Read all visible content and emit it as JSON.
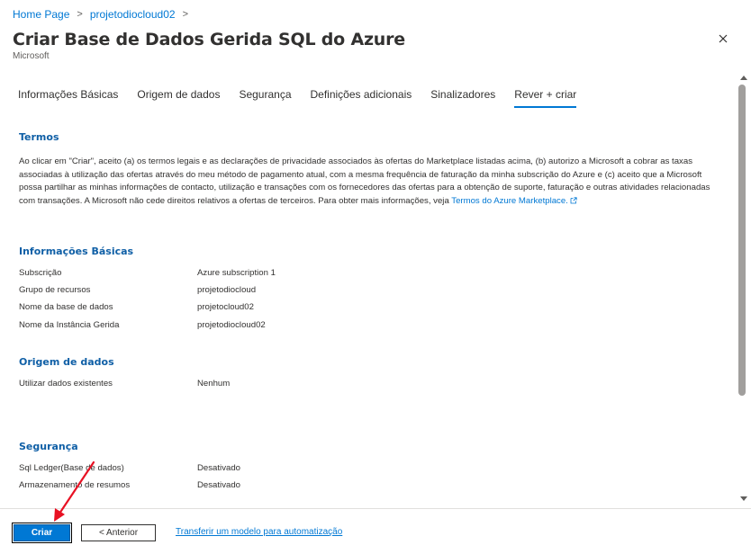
{
  "breadcrumb": {
    "items": [
      "Home Page",
      "projetodiocloud02"
    ],
    "separator": ">"
  },
  "header": {
    "title": "Criar Base de Dados Gerida SQL do Azure",
    "more_label": "···",
    "subtitle": "Microsoft",
    "close_icon": "close-icon"
  },
  "tabs": [
    {
      "label": "Informações Básicas"
    },
    {
      "label": "Origem de dados"
    },
    {
      "label": "Segurança"
    },
    {
      "label": "Definições adicionais"
    },
    {
      "label": "Sinalizadores"
    },
    {
      "label": "Rever + criar",
      "active": true
    }
  ],
  "terms": {
    "title": "Termos",
    "text": "Ao clicar em \"Criar\", aceito (a) os termos legais e as declarações de privacidade associados às ofertas do Marketplace listadas acima, (b) autorizo a Microsoft a cobrar as taxas associadas à utilização das ofertas através do meu método de pagamento atual, com a mesma frequência de faturação da minha subscrição do Azure e (c) aceito que a Microsoft possa partilhar as minhas informações de contacto, utilização e transações com os fornecedores das ofertas para a obtenção de suporte, faturação e outras atividades relacionadas com transações. A Microsoft não cede direitos relativos a ofertas de terceiros. Para obter mais informações, veja ",
    "link": "Termos do Azure Marketplace."
  },
  "basics": {
    "title": "Informações Básicas",
    "rows": [
      {
        "label": "Subscrição",
        "value": "Azure subscription 1"
      },
      {
        "label": "Grupo de recursos",
        "value": "projetodiocloud"
      },
      {
        "label": "Nome da base de dados",
        "value": "projetocloud02"
      },
      {
        "label": "Nome da Instância Gerida",
        "value": "projetodiocloud02"
      }
    ]
  },
  "datasource": {
    "title": "Origem de dados",
    "rows": [
      {
        "label": "Utilizar dados existentes",
        "value": "Nenhum"
      }
    ]
  },
  "security": {
    "title": "Segurança",
    "rows": [
      {
        "label": "Sql Ledger(Base de dados)",
        "value": "Desativado"
      },
      {
        "label": "Armazenamento de resumos",
        "value": "Desativado"
      }
    ]
  },
  "footer": {
    "create_label": "Criar",
    "previous_label": "< Anterior",
    "template_link": "Transferir um modelo para automatização"
  },
  "colors": {
    "accent": "#0078d4",
    "annotation_arrow": "#e81123"
  }
}
